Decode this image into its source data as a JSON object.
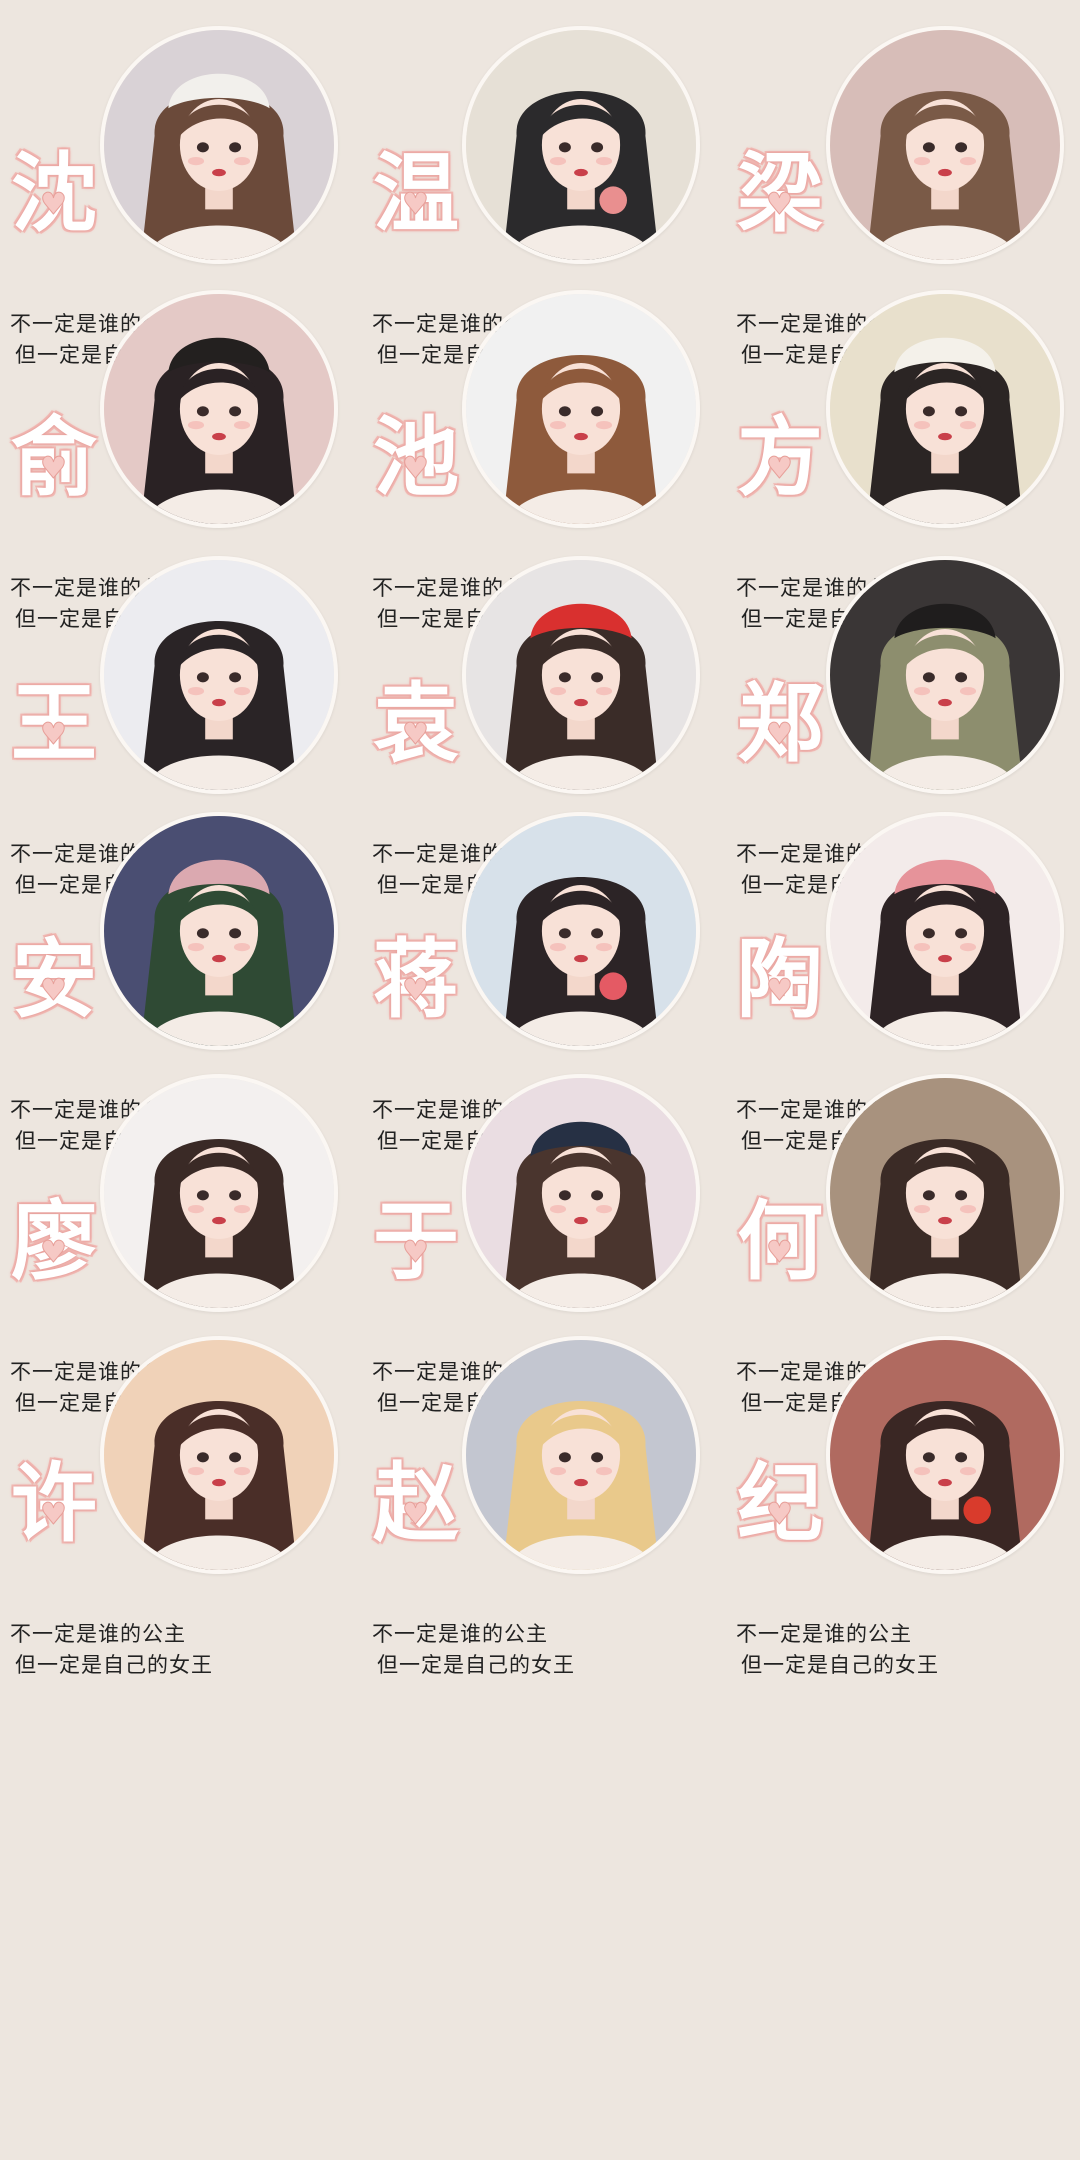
{
  "caption": {
    "line1": "不一定是谁的公主",
    "line2": "但一定是自己的女王"
  },
  "heart_glyph": "♥",
  "cards": [
    {
      "surname": "沈",
      "avatar_bg": "#d9d2d6",
      "hair": "#6b4a3a",
      "hat": "#f2f0ec"
    },
    {
      "surname": "温",
      "avatar_bg": "#e6e0d6",
      "hair": "#2b2a2c",
      "accent": "#e98f8f"
    },
    {
      "surname": "梁",
      "avatar_bg": "#d7bdb8",
      "hair": "#7a5a47"
    },
    {
      "surname": "俞",
      "avatar_bg": "#e4c9c6",
      "hair": "#2a2224",
      "hat": "#23201f"
    },
    {
      "surname": "池",
      "avatar_bg": "#f1f1f1",
      "hair": "#8e5a3c"
    },
    {
      "surname": "方",
      "avatar_bg": "#e8e0cc",
      "hair": "#2b2524",
      "hat": "#f4f1ea"
    },
    {
      "surname": "王",
      "avatar_bg": "#ececf0",
      "hair": "#2a2426"
    },
    {
      "surname": "袁",
      "avatar_bg": "#e7e4e4",
      "hair": "#3a2c28",
      "hat": "#d9302f"
    },
    {
      "surname": "郑",
      "avatar_bg": "#3a3636",
      "hair": "#8d8e6e",
      "hat": "#1f1d1d"
    },
    {
      "surname": "安",
      "avatar_bg": "#4a4e72",
      "hair": "#2f4a34",
      "hat": "#dba9b0"
    },
    {
      "surname": "蒋",
      "avatar_bg": "#d7e1ea",
      "hair": "#2c2426",
      "accent": "#e45a64"
    },
    {
      "surname": "陶",
      "avatar_bg": "#f3ebea",
      "hair": "#2d2325",
      "hat": "#e6939a"
    },
    {
      "surname": "廖",
      "avatar_bg": "#f3f0ef",
      "hair": "#3a2a26"
    },
    {
      "surname": "于",
      "avatar_bg": "#eadde2",
      "hair": "#4a352e",
      "hat": "#263044"
    },
    {
      "surname": "何",
      "avatar_bg": "#a8927e",
      "hair": "#3b2b26"
    },
    {
      "surname": "许",
      "avatar_bg": "#f0d2b8",
      "hair": "#4a2e28"
    },
    {
      "surname": "赵",
      "avatar_bg": "#c3c6d0",
      "hair": "#e9c98b"
    },
    {
      "surname": "纪",
      "avatar_bg": "#b06a60",
      "hair": "#3a2724",
      "accent": "#d93b2c"
    }
  ]
}
